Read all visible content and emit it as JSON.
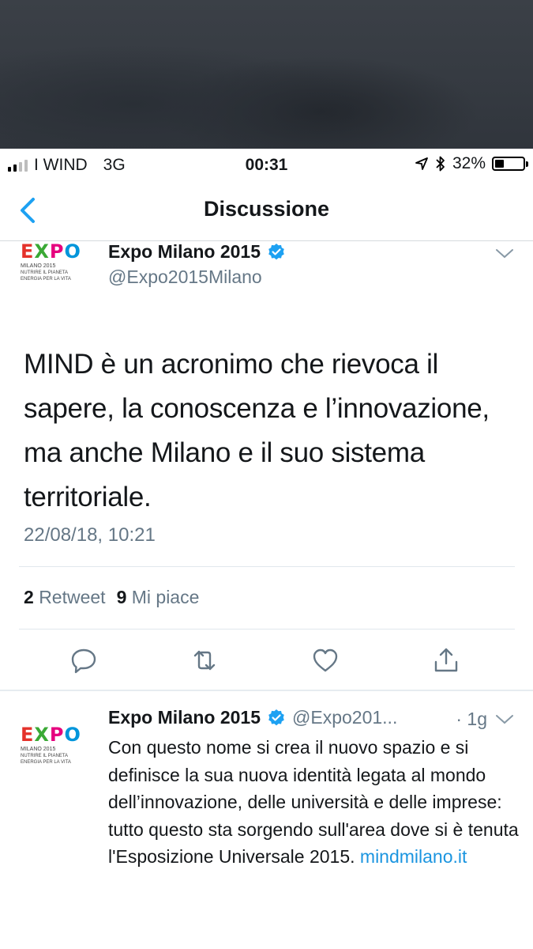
{
  "status_bar": {
    "carrier": "I WIND",
    "network": "3G",
    "time": "00:31",
    "battery_percent": "32%",
    "battery_level": 0.32
  },
  "nav": {
    "title": "Discussione"
  },
  "main_tweet": {
    "display_name": "Expo Milano 2015",
    "handle": "@Expo2015Milano",
    "text": "MIND è un acronimo che rievoca il sapere, la conoscenza e l’innovazione, ma anche Milano e il suo sistema territoriale.",
    "timestamp": "22/08/18, 10:21",
    "retweet_count": "2",
    "retweet_label": "Retweet",
    "like_count": "9",
    "like_label": "Mi piace"
  },
  "avatar_logo": {
    "letters": [
      "E",
      "X",
      "P",
      "O"
    ],
    "colors": [
      "#e4322b",
      "#3aa935",
      "#e6007e",
      "#0095db"
    ],
    "line1": "MILANO 2015",
    "line2": "NUTRIRE IL PIANETA",
    "line3": "ENERGIA PER LA VITA"
  },
  "reply_tweet": {
    "display_name": "Expo Milano 2015",
    "handle": "@Expo201...",
    "age": "· 1g",
    "text": "Con questo nome si crea il nuovo spazio e si definisce la sua nuova identità legata al mondo dell’innovazione, delle università e delle imprese:\ntutto questo sta sorgendo sull'area dove si è tenuta l'Esposizione Universale 2015.",
    "link": "mindmilano.it"
  },
  "colors": {
    "accent": "#1da1f2",
    "muted": "#657786",
    "link": "#1b95e0"
  }
}
